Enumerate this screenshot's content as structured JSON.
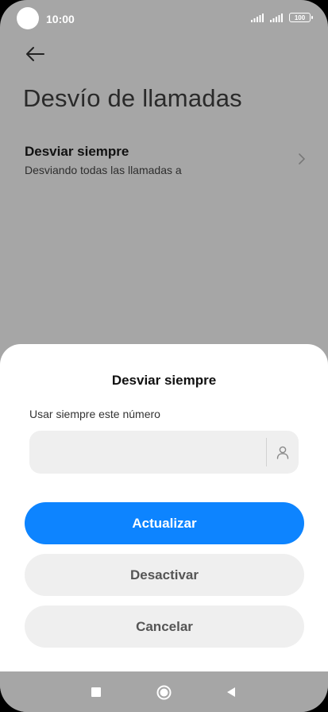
{
  "status_bar": {
    "time": "10:00",
    "battery": "100",
    "icons": [
      "signal-icon",
      "signal-icon",
      "battery-icon"
    ]
  },
  "header": {
    "back_icon": "arrow-left-icon",
    "title": "Desvío de llamadas"
  },
  "setting": {
    "title": "Desviar siempre",
    "subtitle": "Desviando todas las llamadas a",
    "icon": "chevron-right-icon"
  },
  "dialog": {
    "title": "Desviar siempre",
    "field_label": "Usar siempre este número",
    "input_value": "",
    "contact_icon": "person-icon",
    "primary_button": "Actualizar",
    "deactivate_button": "Desactivar",
    "cancel_button": "Cancelar"
  },
  "nav": {
    "icons": [
      "recents-square-icon",
      "home-circle-icon",
      "back-triangle-icon"
    ]
  },
  "colors": {
    "overlay": "#a6a6a6",
    "primary": "#0d84ff",
    "secondary_bg": "#efefef"
  }
}
